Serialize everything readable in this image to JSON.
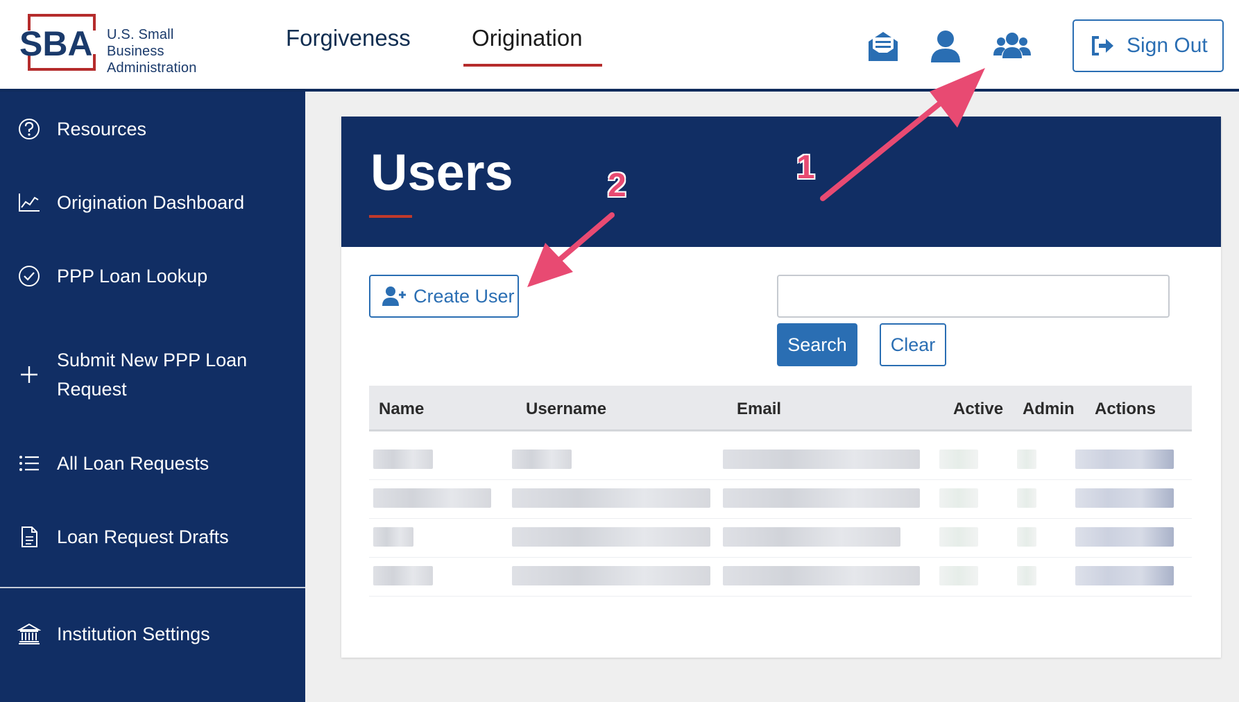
{
  "header": {
    "logo_mark": "SBA",
    "logo_line1": "U.S. Small Business",
    "logo_line2": "Administration",
    "nav": [
      {
        "label": "Forgiveness"
      },
      {
        "label": "Origination",
        "active": true
      }
    ],
    "icons": [
      "messages-icon",
      "user-icon",
      "users-icon"
    ],
    "signout_label": "Sign Out"
  },
  "sidebar": {
    "items": [
      {
        "label": "Resources",
        "icon": "question-circle-icon"
      },
      {
        "label": "Origination Dashboard",
        "icon": "chart-line-icon"
      },
      {
        "label": "PPP Loan Lookup",
        "icon": "check-circle-icon"
      },
      {
        "label": "Submit New PPP Loan Request",
        "icon": "plus-icon"
      },
      {
        "label": "All Loan Requests",
        "icon": "list-icon"
      },
      {
        "label": "Loan Request Drafts",
        "icon": "document-icon"
      },
      {
        "label": "Institution Settings",
        "icon": "bank-icon"
      }
    ]
  },
  "main": {
    "title": "Users",
    "create_label": "Create User",
    "search_value": "",
    "search_label": "Search",
    "clear_label": "Clear",
    "columns": [
      "Name",
      "Username",
      "Email",
      "Active",
      "Admin",
      "Actions"
    ]
  },
  "annotations": [
    "1",
    "2"
  ],
  "colors": {
    "navy": "#112e64",
    "accent_blue": "#2a6eb3",
    "accent_red": "#b52c2c",
    "arrow_pink": "#e84a72"
  }
}
